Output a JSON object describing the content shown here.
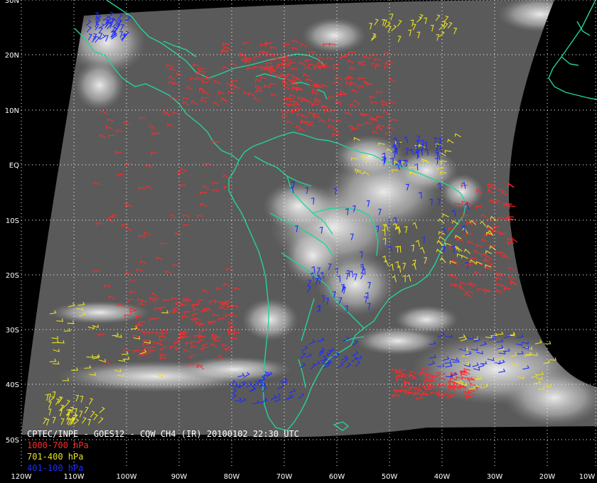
{
  "title": "CPTEC/INPE - GOES12 - CQW CH4 (IR) 20100102 22:30 UTC",
  "legend": [
    {
      "label": "1000-700 hPa",
      "color": "#ff2a2a"
    },
    {
      "label": "701-400 hPa",
      "color": "#e8e020"
    },
    {
      "label": "401-100 hPa",
      "color": "#1e2cff"
    }
  ],
  "colors": {
    "background": "#000000",
    "satellite_field": "#5a5a5a",
    "cloud": "#e6e6e6",
    "coastline": "#22d39a",
    "graticule": "#ffffff",
    "label": "#ffffff"
  },
  "latitude_labels": [
    "30N",
    "20N",
    "10N",
    "EQ",
    "10S",
    "20S",
    "30S",
    "40S",
    "50S"
  ],
  "longitude_labels": [
    "120W",
    "110W",
    "100W",
    "90W",
    "80W",
    "70W",
    "60W",
    "50W",
    "40W",
    "30W",
    "20W",
    "10W"
  ]
}
